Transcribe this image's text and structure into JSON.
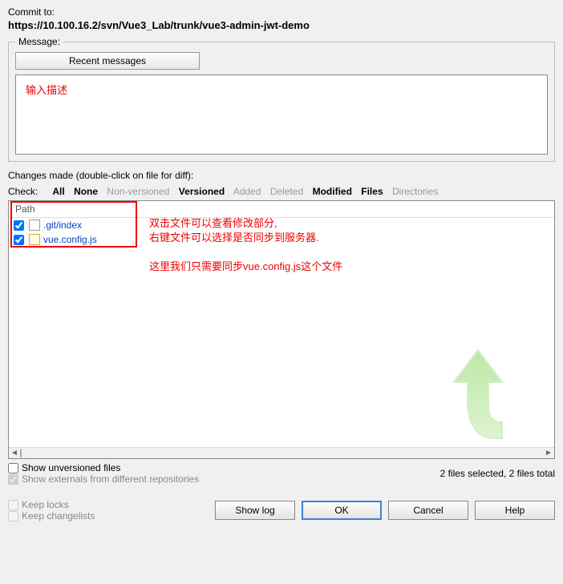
{
  "commit_to_label": "Commit to:",
  "url": "https://10.100.16.2/svn/Vue3_Lab/trunk/vue3-admin-jwt-demo",
  "message": {
    "legend": "Message:",
    "recent_btn": "Recent messages",
    "placeholder_annotation": "输入描述"
  },
  "changes": {
    "label": "Changes made (double-click on file for diff):",
    "check_label": "Check:",
    "all": "All",
    "none": "None",
    "non_versioned": "Non-versioned",
    "versioned": "Versioned",
    "added": "Added",
    "deleted": "Deleted",
    "modified": "Modified",
    "files": "Files",
    "directories": "Directories",
    "path_header": "Path",
    "file1": ".git/index",
    "file2": "vue.config.js",
    "annotation_line1": "双击文件可以查看修改部分,",
    "annotation_line2": "右键文件可以选择是否同步到服务器.",
    "annotation_line3": "这里我们只需要同步vue.config.js这个文件"
  },
  "show_unversioned": "Show unversioned files",
  "show_externals": "Show externals from different repositories",
  "status": "2 files selected, 2 files total",
  "keep_locks": "Keep locks",
  "keep_changelists": "Keep changelists",
  "buttons": {
    "show_log": "Show log",
    "ok": "OK",
    "cancel": "Cancel",
    "help": "Help"
  }
}
